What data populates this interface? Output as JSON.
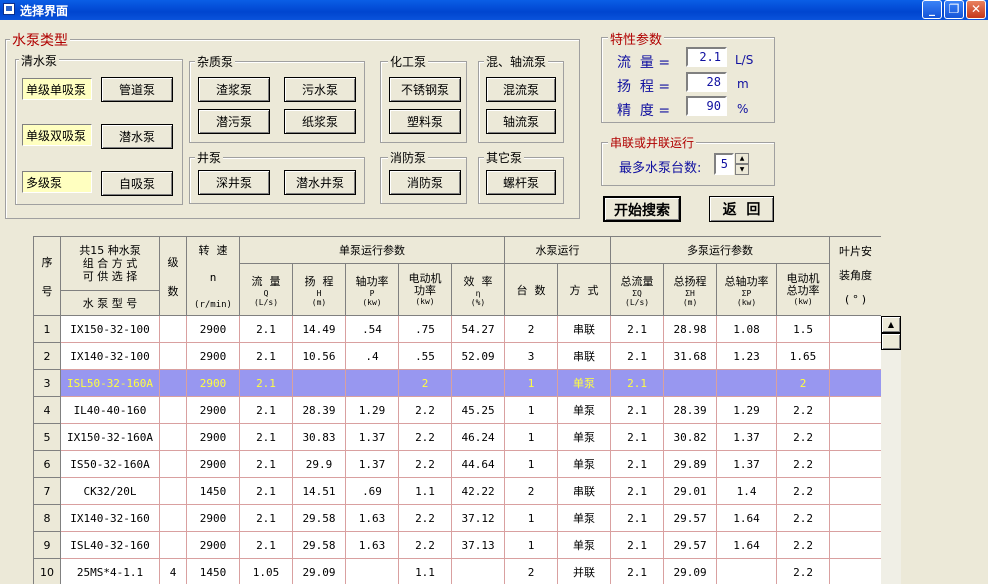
{
  "window": {
    "title": "选择界面"
  },
  "pump_types": {
    "title": "水泵类型",
    "clean_water": {
      "title": "清水泵",
      "buttons": [
        "单级单吸泵",
        "单级双吸泵",
        "多级泵"
      ],
      "right_buttons": [
        "管道泵",
        "潜水泵",
        "自吸泵"
      ]
    },
    "misc": {
      "title": "杂质泵",
      "buttons": [
        "渣浆泵",
        "污水泵",
        "潜污泵",
        "纸浆泵"
      ]
    },
    "well": {
      "title": "井泵",
      "buttons": [
        "深井泵",
        "潜水井泵"
      ]
    },
    "chemical": {
      "title": "化工泵",
      "buttons": [
        "不锈钢泵",
        "塑料泵"
      ]
    },
    "fire": {
      "title": "消防泵",
      "buttons": [
        "消防泵"
      ]
    },
    "mixed": {
      "title": "混、轴流泵",
      "buttons": [
        "混流泵",
        "轴流泵"
      ]
    },
    "other": {
      "title": "其它泵",
      "buttons": [
        "螺杆泵"
      ]
    }
  },
  "params": {
    "title": "特性参数",
    "flow": {
      "label": "流  量 =",
      "value": "2.1",
      "unit": "L/S"
    },
    "head": {
      "label": "扬  程 =",
      "value": "28",
      "unit": "m"
    },
    "accuracy": {
      "label": "精  度 =",
      "value": "90",
      "unit": "%"
    }
  },
  "series_parallel": {
    "title": "串联或并联运行",
    "label": "最多水泵台数:",
    "value": "5"
  },
  "actions": {
    "search": "开始搜索",
    "back": "返  回"
  },
  "table": {
    "h_seq": "序\n\n号",
    "h_combo": "共15 种水泵\n组 合 方 式\n可 供 选 择",
    "h_model": "水 泵 型 号",
    "h_stage": "级\n\n数",
    "h_speed": "转  速",
    "h_speed_sym": "n",
    "h_speed_unit": "(r/min)",
    "h_single": "单泵运行参数",
    "h_pump_run": "水泵运行",
    "h_multi": "多泵运行参数",
    "h_blade": "叶片安\n\n装角度\n\n( ° )",
    "single_cols": [
      {
        "name": "流  量",
        "sym": "Q",
        "unit": "(L/s)"
      },
      {
        "name": "扬  程",
        "sym": "H",
        "unit": "(m)"
      },
      {
        "name": "轴功率",
        "sym": "P",
        "unit": "(kw)"
      },
      {
        "name": "电动机\n功率",
        "sym": "",
        "unit": "(kw)"
      },
      {
        "name": "效  率",
        "sym": "η",
        "unit": "(%)"
      }
    ],
    "run_cols": [
      "台  数",
      "方  式"
    ],
    "multi_cols": [
      {
        "name": "总流量",
        "sym": "ΣQ",
        "unit": "(L/s)"
      },
      {
        "name": "总扬程",
        "sym": "ΣH",
        "unit": "(m)"
      },
      {
        "name": "总轴功率",
        "sym": "ΣP",
        "unit": "(kw)"
      },
      {
        "name": "电动机\n总功率",
        "sym": "",
        "unit": "(kw)"
      }
    ],
    "rows": [
      {
        "no": "1",
        "model": "IX150-32-100",
        "stage": "",
        "speed": "2900",
        "q": "2.1",
        "h": "14.49",
        "p": ".54",
        "motor": ".75",
        "eff": "54.27",
        "count": "2",
        "mode": "串联",
        "tq": "2.1",
        "th": "28.98",
        "tp": "1.08",
        "tm": "1.5",
        "blade": ""
      },
      {
        "no": "2",
        "model": "IX140-32-100",
        "stage": "",
        "speed": "2900",
        "q": "2.1",
        "h": "10.56",
        "p": ".4",
        "motor": ".55",
        "eff": "52.09",
        "count": "3",
        "mode": "串联",
        "tq": "2.1",
        "th": "31.68",
        "tp": "1.23",
        "tm": "1.65",
        "blade": ""
      },
      {
        "no": "3",
        "model": "ISL50-32-160A",
        "stage": "",
        "speed": "2900",
        "q": "2.1",
        "h": "",
        "p": "",
        "motor": "2",
        "eff": "",
        "count": "1",
        "mode": "单泵",
        "tq": "2.1",
        "th": "",
        "tp": "",
        "tm": "2",
        "blade": "",
        "selected": true
      },
      {
        "no": "4",
        "model": "IL40-40-160",
        "stage": "",
        "speed": "2900",
        "q": "2.1",
        "h": "28.39",
        "p": "1.29",
        "motor": "2.2",
        "eff": "45.25",
        "count": "1",
        "mode": "单泵",
        "tq": "2.1",
        "th": "28.39",
        "tp": "1.29",
        "tm": "2.2",
        "blade": ""
      },
      {
        "no": "5",
        "model": "IX150-32-160A",
        "stage": "",
        "speed": "2900",
        "q": "2.1",
        "h": "30.83",
        "p": "1.37",
        "motor": "2.2",
        "eff": "46.24",
        "count": "1",
        "mode": "单泵",
        "tq": "2.1",
        "th": "30.82",
        "tp": "1.37",
        "tm": "2.2",
        "blade": ""
      },
      {
        "no": "6",
        "model": "IS50-32-160A",
        "stage": "",
        "speed": "2900",
        "q": "2.1",
        "h": "29.9",
        "p": "1.37",
        "motor": "2.2",
        "eff": "44.64",
        "count": "1",
        "mode": "单泵",
        "tq": "2.1",
        "th": "29.89",
        "tp": "1.37",
        "tm": "2.2",
        "blade": ""
      },
      {
        "no": "7",
        "model": "CK32/20L",
        "stage": "",
        "speed": "1450",
        "q": "2.1",
        "h": "14.51",
        "p": ".69",
        "motor": "1.1",
        "eff": "42.22",
        "count": "2",
        "mode": "串联",
        "tq": "2.1",
        "th": "29.01",
        "tp": "1.4",
        "tm": "2.2",
        "blade": ""
      },
      {
        "no": "8",
        "model": "IX140-32-160",
        "stage": "",
        "speed": "2900",
        "q": "2.1",
        "h": "29.58",
        "p": "1.63",
        "motor": "2.2",
        "eff": "37.12",
        "count": "1",
        "mode": "单泵",
        "tq": "2.1",
        "th": "29.57",
        "tp": "1.64",
        "tm": "2.2",
        "blade": ""
      },
      {
        "no": "9",
        "model": "ISL40-32-160",
        "stage": "",
        "speed": "2900",
        "q": "2.1",
        "h": "29.58",
        "p": "1.63",
        "motor": "2.2",
        "eff": "37.13",
        "count": "1",
        "mode": "单泵",
        "tq": "2.1",
        "th": "29.57",
        "tp": "1.64",
        "tm": "2.2",
        "blade": ""
      },
      {
        "no": "10",
        "model": "25MS*4-1.1",
        "stage": "4",
        "speed": "1450",
        "q": "1.05",
        "h": "29.09",
        "p": "",
        "motor": "1.1",
        "eff": "",
        "count": "2",
        "mode": "并联",
        "tq": "2.1",
        "th": "29.09",
        "tp": "",
        "tm": "2.2",
        "blade": ""
      }
    ]
  }
}
